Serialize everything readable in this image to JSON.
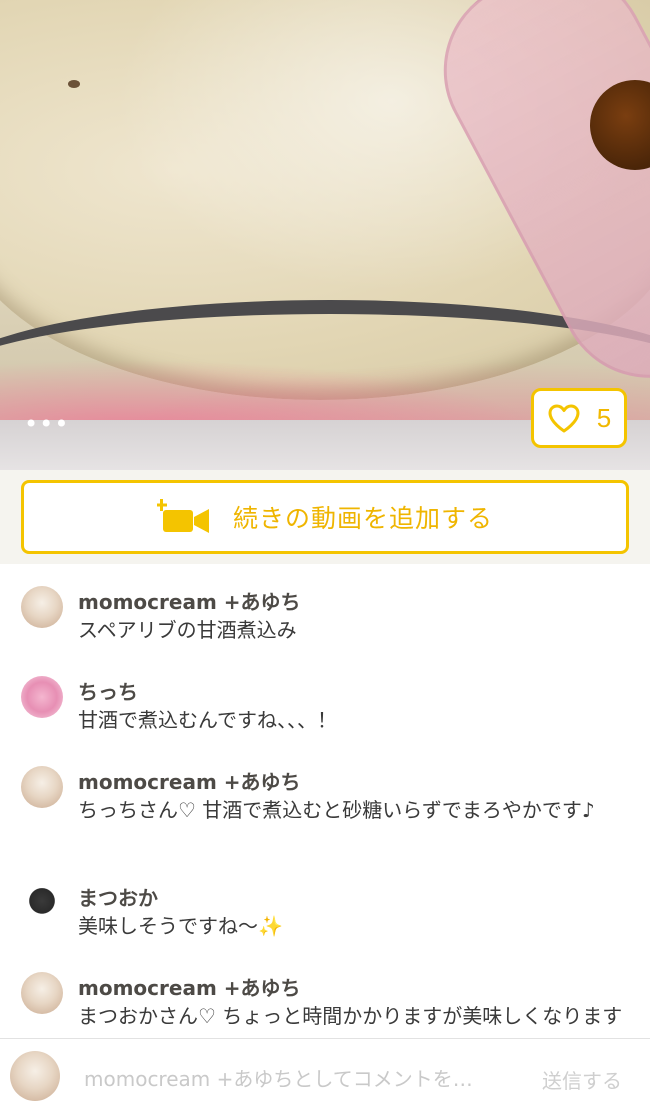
{
  "video": {
    "more_label": "•••",
    "like_count": "5",
    "accent_color": "#f4c400"
  },
  "add_video": {
    "label": "続きの動画を追加する"
  },
  "comments": [
    {
      "user": "momocream +あゆち",
      "text": "スペアリブの甘酒煮込み"
    },
    {
      "user": "ちっち",
      "text": "甘酒で煮込むんですね、、、！"
    },
    {
      "user": "momocream +あゆち",
      "text": "ちっちさん♡ 甘酒で煮込むと砂糖いらずでまろやかです♪"
    },
    {
      "user": "まつおか",
      "text": "美味しそうですね〜✨"
    },
    {
      "user": "momocream +あゆち",
      "text": "まつおかさん♡ ちょっと時間かかりますが美味しくなりますよ〜"
    }
  ],
  "input": {
    "placeholder": "momocream +あゆちとしてコメントを…",
    "send_label": "送信する"
  }
}
